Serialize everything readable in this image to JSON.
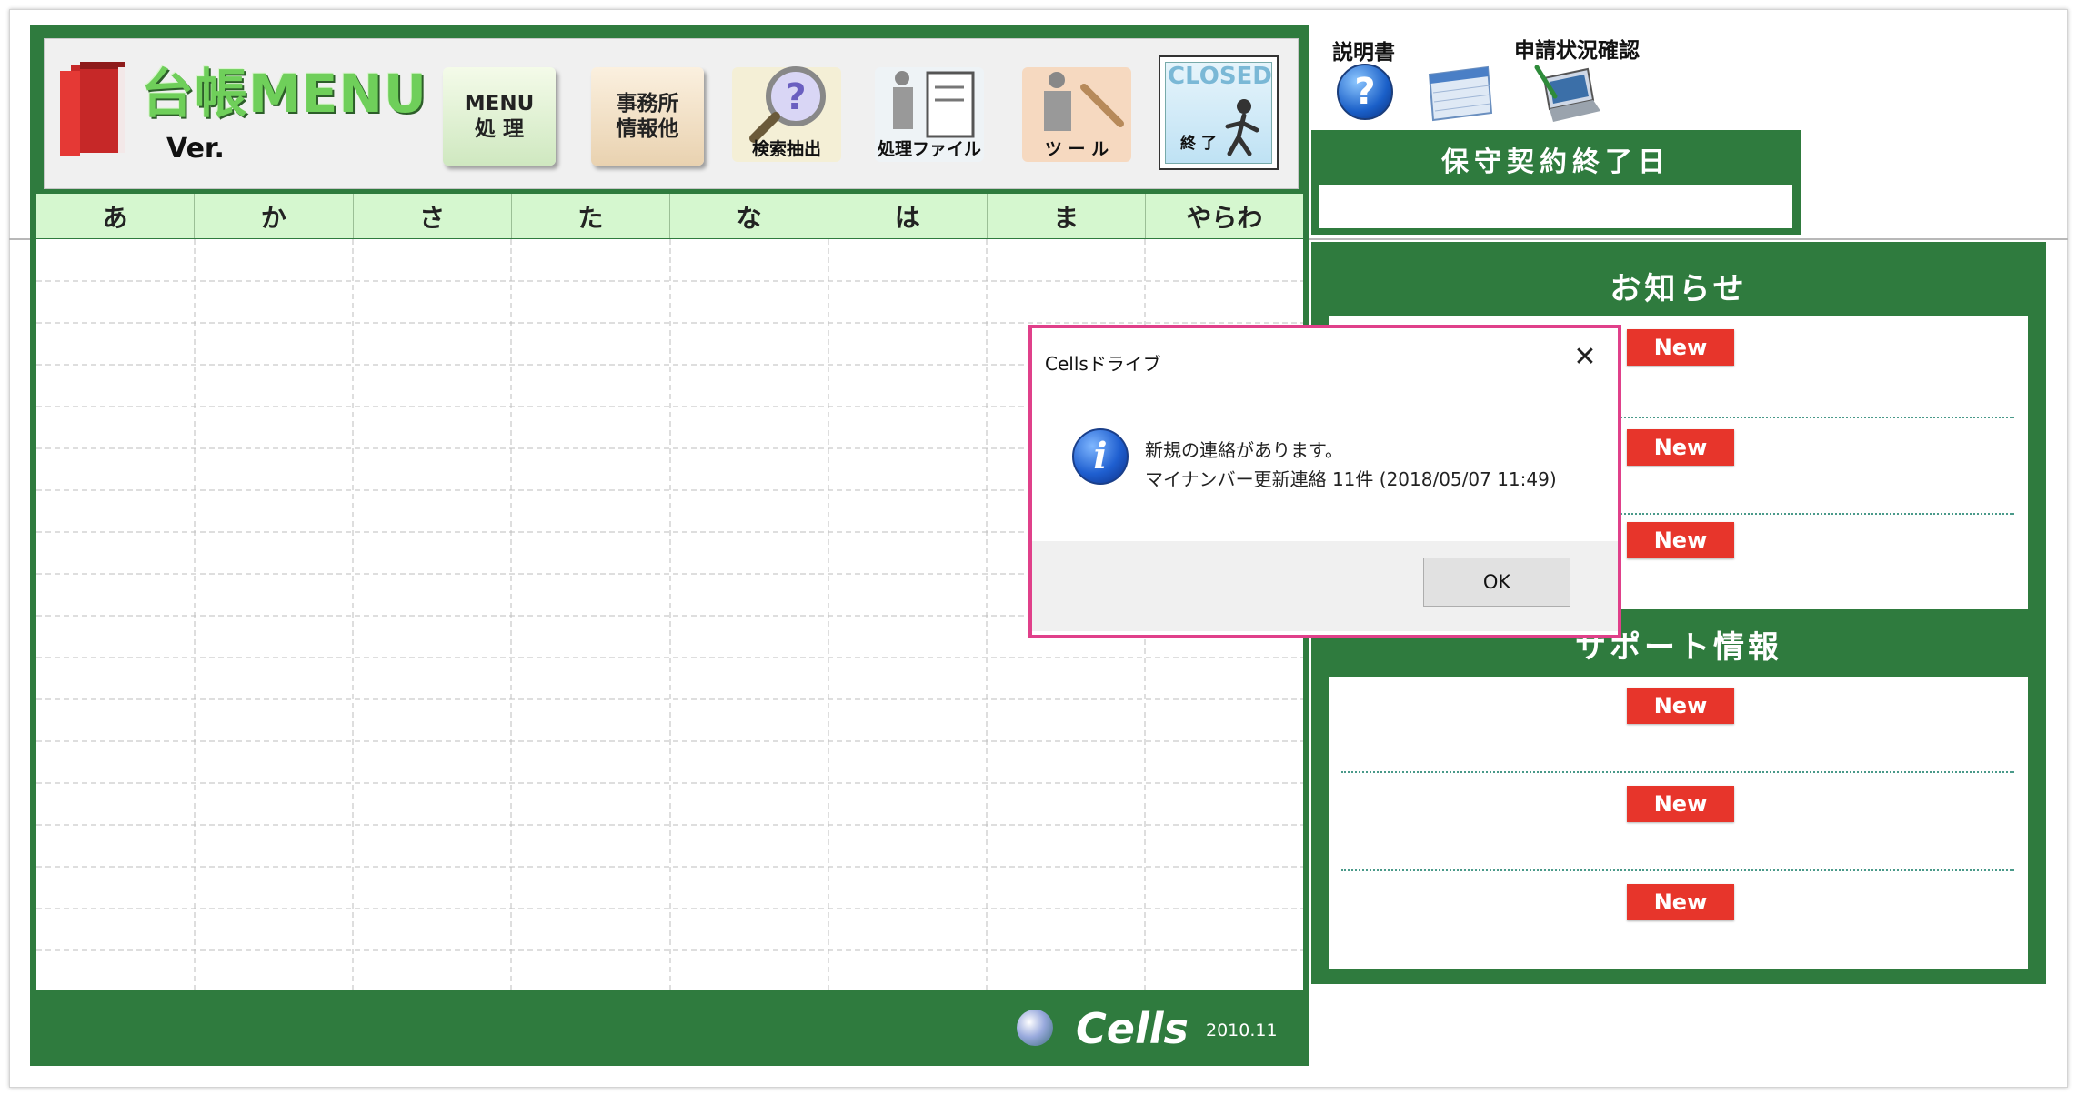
{
  "header": {
    "app_title": "台帳MENU",
    "version_label": "Ver.",
    "buttons": {
      "menu": "MENU\n処 理",
      "office": "事務所\n情報他",
      "search": "検索抽出",
      "files": "処理ファイル",
      "tools": "ツ ー ル",
      "closed": "CLOSED",
      "exit": "終 了"
    }
  },
  "kana_tabs": [
    "あ",
    "か",
    "さ",
    "た",
    "な",
    "は",
    "ま",
    "やらわ"
  ],
  "footer": {
    "brand": "Cells",
    "year": "2010.11"
  },
  "top_links": {
    "manual": "説明書",
    "status_check": "申請状況確認"
  },
  "maintenance": {
    "title": "保守契約終了日",
    "value": ""
  },
  "news": {
    "title": "お知らせ",
    "badges": [
      "New",
      "New",
      "New"
    ]
  },
  "support": {
    "title": "サポート情報",
    "badges": [
      "New",
      "New",
      "New"
    ]
  },
  "dialog": {
    "title": "Cellsドライブ",
    "line1": "新規の連絡があります。",
    "line2": "マイナンバー更新連絡 11件 (2018/05/07 11:49)",
    "ok_label": "OK",
    "close_glyph": "✕"
  },
  "colors": {
    "panel_green": "#2f7b3e",
    "tab_bg": "#d5f7cf",
    "new_red": "#e7352b",
    "dialog_border": "#e0408a"
  }
}
